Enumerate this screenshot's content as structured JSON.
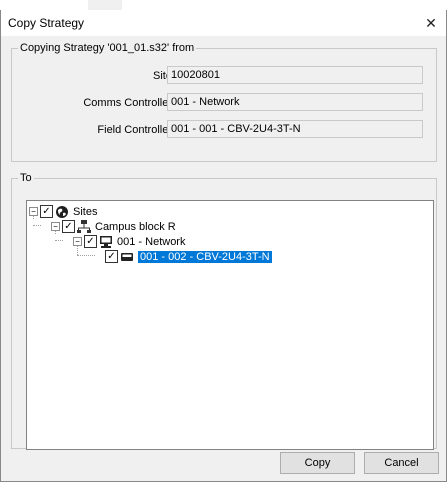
{
  "window": {
    "title": "Copy Strategy",
    "close_glyph": "✕"
  },
  "from": {
    "legend": "Copying Strategy '001_01.s32' from",
    "site_label": "Site",
    "site_value": "10020801",
    "comms_label": "Comms Controller",
    "comms_value": "001 - Network",
    "field_label": "Field Controller",
    "field_value": "001 - 001 - CBV-2U4-3T-N"
  },
  "to": {
    "legend": "To",
    "tree": {
      "sites": "Sites",
      "campus": "Campus block R",
      "network": "001 - Network",
      "controller": "001 - 002 - CBV-2U4-3T-N"
    }
  },
  "buttons": {
    "copy": "Copy",
    "cancel": "Cancel"
  },
  "colors": {
    "selection": "#0078d7",
    "window_bg": "#f0f0f0"
  },
  "icons": [
    "globe-icon",
    "network-icon",
    "computer-icon",
    "controller-icon"
  ]
}
